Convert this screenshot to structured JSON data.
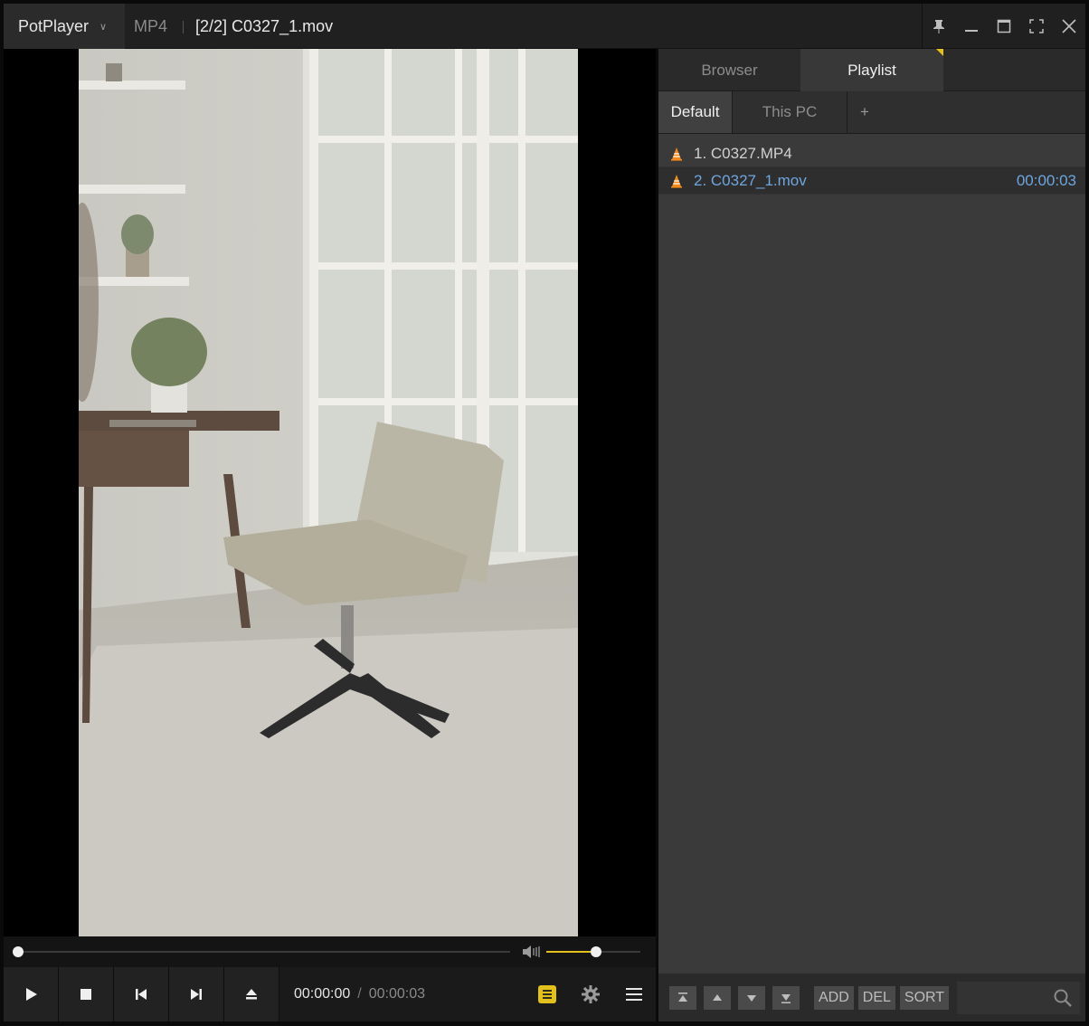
{
  "titlebar": {
    "app_name": "PotPlayer",
    "format": "MP4",
    "file_title": "[2/2] C0327_1.mov",
    "icons": [
      "pin-icon",
      "minimize-icon",
      "maximize-icon",
      "fullscreen-icon",
      "close-icon"
    ]
  },
  "player": {
    "current_time": "00:00:00",
    "time_separator": "/",
    "total_time": "00:00:03",
    "seek_progress": 0,
    "volume_level": 0.53,
    "accent_color": "#e3c11c"
  },
  "panel": {
    "tabs": [
      {
        "label": "Browser",
        "active": false
      },
      {
        "label": "Playlist",
        "active": true
      }
    ],
    "subtabs": [
      {
        "label": "Default",
        "active": true
      },
      {
        "label": "This PC",
        "active": false
      },
      {
        "label": "+"
      }
    ],
    "items": [
      {
        "label": "1. C0327.MP4",
        "duration": "",
        "active": false
      },
      {
        "label": "2. C0327_1.mov",
        "duration": "00:00:03",
        "active": true
      }
    ],
    "bottom_buttons": {
      "add": "ADD",
      "del": "DEL",
      "sort": "SORT"
    },
    "active_color": "#6ea6e0"
  }
}
